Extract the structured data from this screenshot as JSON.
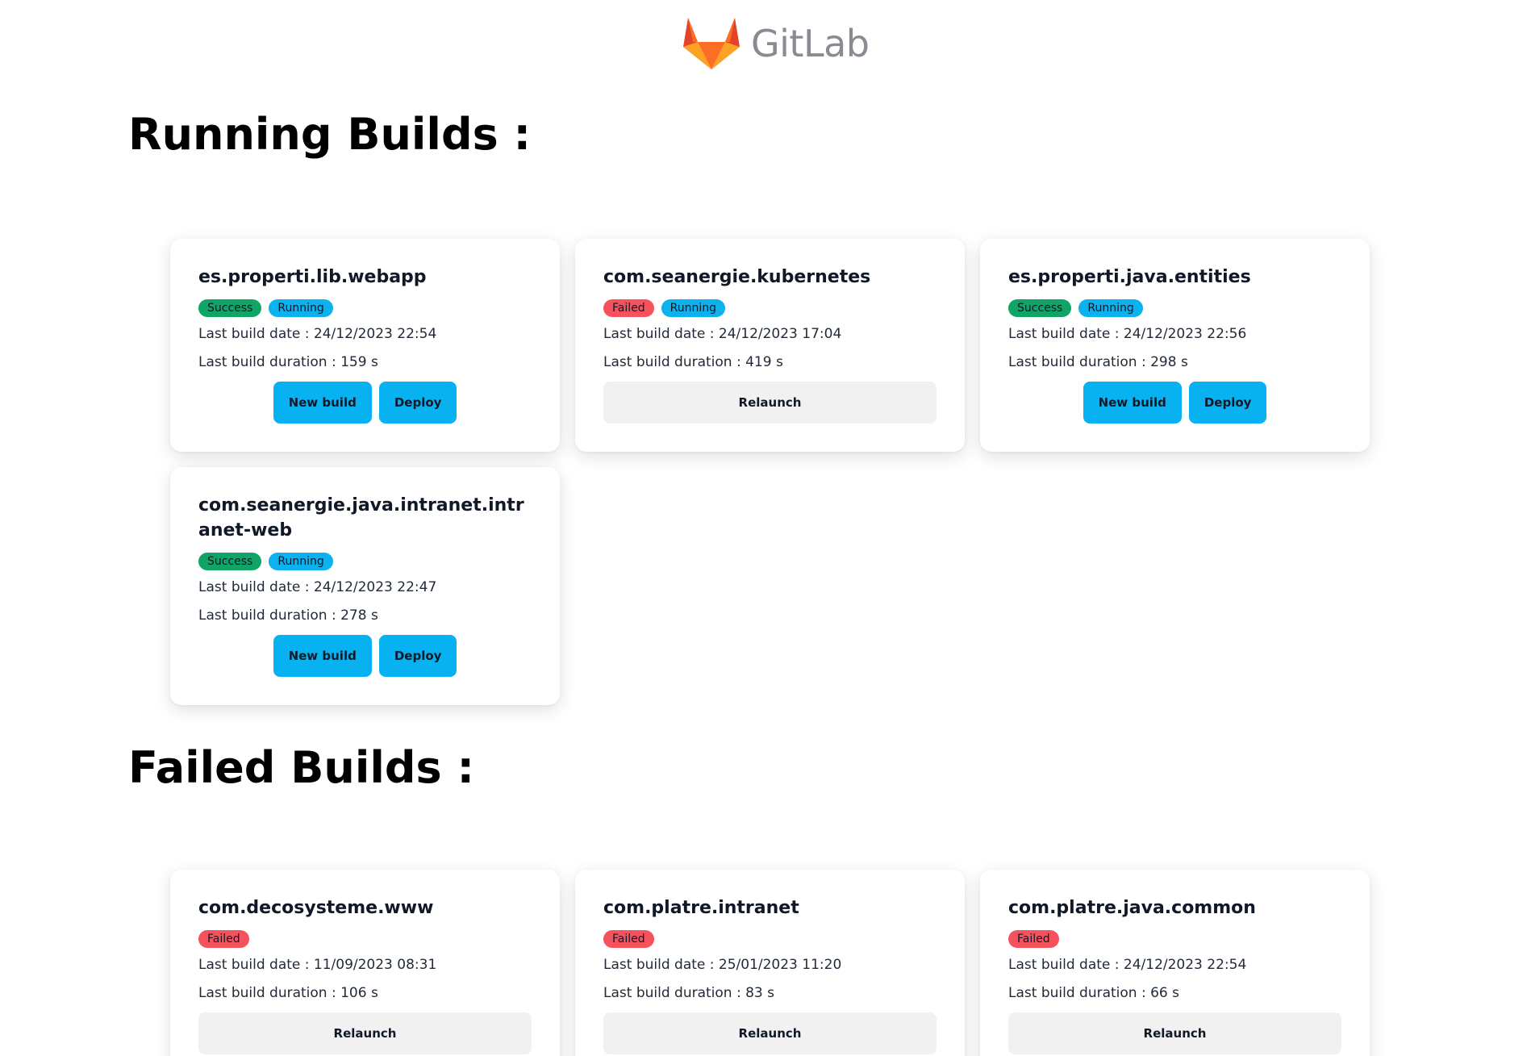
{
  "logo": {
    "text": "GitLab",
    "icon": "gitlab-tanuki-icon"
  },
  "colors": {
    "success": "#10a566",
    "running": "#0bb2ee",
    "failed": "#f6525d",
    "primary_button": "#08b2f0",
    "relaunch_button": "#f1f1f1"
  },
  "running": {
    "title": "Running Builds :",
    "cards": [
      {
        "name": "es.properti.lib.webapp",
        "badges": [
          "Success",
          "Running"
        ],
        "date": "Last build date : 24/12/2023 22:54",
        "duration": "Last build duration : 159 s",
        "buttons": [
          "New build",
          "Deploy"
        ]
      },
      {
        "name": "com.seanergie.kubernetes",
        "badges": [
          "Failed",
          "Running"
        ],
        "date": "Last build date : 24/12/2023 17:04",
        "duration": "Last build duration : 419 s",
        "buttons": [
          "Relaunch"
        ]
      },
      {
        "name": "es.properti.java.entities",
        "badges": [
          "Success",
          "Running"
        ],
        "date": "Last build date : 24/12/2023 22:56",
        "duration": "Last build duration : 298 s",
        "buttons": [
          "New build",
          "Deploy"
        ]
      },
      {
        "name": "com.seanergie.java.intranet.intranet-web",
        "badges": [
          "Success",
          "Running"
        ],
        "date": "Last build date : 24/12/2023 22:47",
        "duration": "Last build duration : 278 s",
        "buttons": [
          "New build",
          "Deploy"
        ]
      }
    ]
  },
  "failed": {
    "title": "Failed Builds :",
    "cards": [
      {
        "name": "com.decosysteme.www",
        "badges": [
          "Failed"
        ],
        "date": "Last build date : 11/09/2023 08:31",
        "duration": "Last build duration : 106 s",
        "buttons": [
          "Relaunch"
        ]
      },
      {
        "name": "com.platre.intranet",
        "badges": [
          "Failed"
        ],
        "date": "Last build date : 25/01/2023 11:20",
        "duration": "Last build duration : 83 s",
        "buttons": [
          "Relaunch"
        ]
      },
      {
        "name": "com.platre.java.common",
        "badges": [
          "Failed"
        ],
        "date": "Last build date : 24/12/2023 22:54",
        "duration": "Last build duration : 66 s",
        "buttons": [
          "Relaunch"
        ]
      }
    ]
  }
}
